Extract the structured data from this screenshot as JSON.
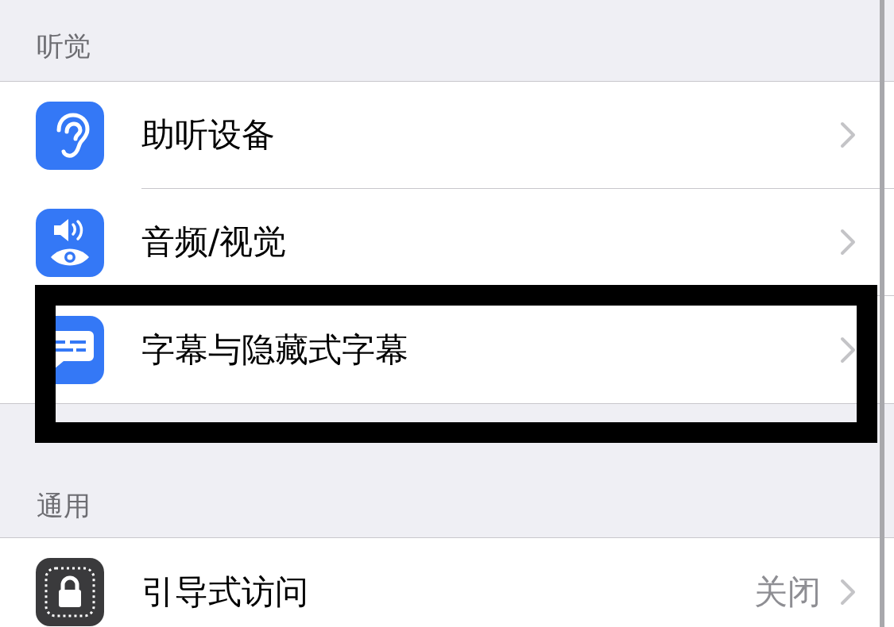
{
  "sections": [
    {
      "header": "听觉",
      "rows": [
        {
          "label": "助听设备",
          "color": "#3478f6",
          "highlighted": false
        },
        {
          "label": "音频/视觉",
          "color": "#3478f6",
          "highlighted": false
        },
        {
          "label": "字幕与隐藏式字幕",
          "color": "#3478f6",
          "highlighted": true
        }
      ]
    },
    {
      "header": "通用",
      "rows": [
        {
          "label": "引导式访问",
          "color": "#3a3a3c",
          "value": "关闭",
          "highlighted": false
        }
      ]
    }
  ]
}
